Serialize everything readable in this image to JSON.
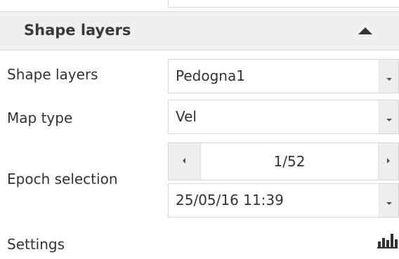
{
  "panel": {
    "title": "Shape layers",
    "collapse_icon": "triangle-up-icon"
  },
  "fields": {
    "shape_layers": {
      "label": "Shape layers",
      "value": "Pedogna1"
    },
    "map_type": {
      "label": "Map type",
      "value": "Vel"
    },
    "epoch": {
      "label": "Epoch selection",
      "counter": "1/52",
      "datetime": "25/05/16 11:39"
    }
  },
  "settings": {
    "label": "Settings",
    "icon": "bar-chart-icon"
  },
  "colors": {
    "header_bg": "#efefef",
    "border": "#d6d6d6",
    "button_bg": "#eeeeee",
    "text": "#333333"
  }
}
